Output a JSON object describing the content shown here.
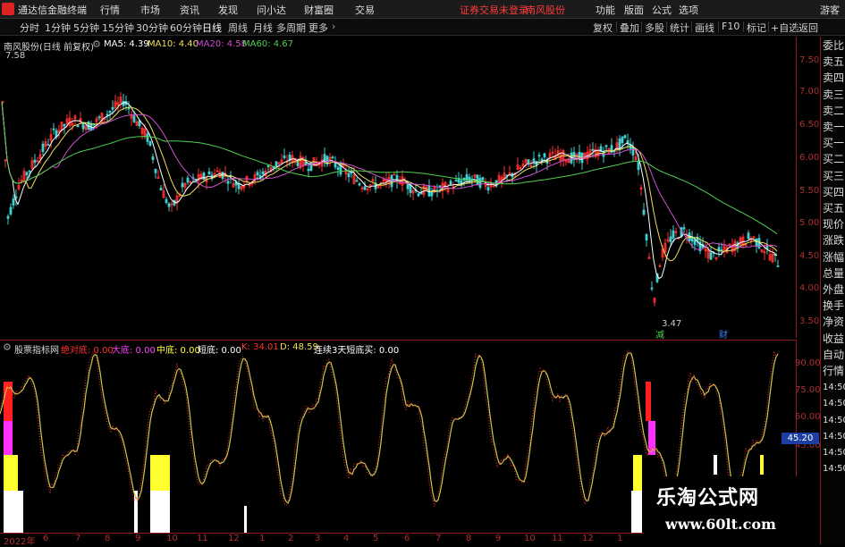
{
  "menubar": {
    "brand": "通达信金融终端",
    "menus": [
      "行情",
      "市场",
      "资讯",
      "发现",
      "问小达",
      "财富圈",
      "交易"
    ],
    "status": "证券交易未登录",
    "stock_name": "南风股份",
    "right_menus": [
      "功能",
      "版面",
      "公式",
      "选项"
    ],
    "guest": "游客"
  },
  "toolbar": {
    "periods": [
      "分时",
      "1分钟",
      "5分钟",
      "15分钟",
      "30分钟",
      "60分钟",
      "日线",
      "周线",
      "月线",
      "多周期",
      "更多"
    ],
    "active_period": "日线",
    "tools": [
      "复权",
      "叠加",
      "多股",
      "统计",
      "画线",
      "F10",
      "标记",
      "+自选",
      "返回"
    ]
  },
  "main_chart": {
    "title": "南风股份(日线 前复权)",
    "ma_labels": [
      {
        "text": "MA5: 4.39",
        "color": "#ffffff"
      },
      {
        "text": "MA10: 4.40",
        "color": "#f0e05a"
      },
      {
        "text": "MA20: 4.58",
        "color": "#d050d0"
      },
      {
        "text": "MA60: 4.67",
        "color": "#50d050"
      }
    ],
    "y_ticks": [
      "7.50",
      "7.00",
      "6.50",
      "6.00",
      "5.50",
      "5.00",
      "4.50",
      "4.00",
      "3.50"
    ],
    "high_label": "7.58",
    "low_label": "3.47",
    "markers": [
      "减",
      "财"
    ]
  },
  "indicator": {
    "title": "股票指标网",
    "labels": [
      {
        "text": "绝对底: 0.00",
        "color": "#ff3030"
      },
      {
        "text": "大底: 0.00",
        "color": "#ff40ff"
      },
      {
        "text": "中底: 0.00",
        "color": "#ffff40"
      },
      {
        "text": "短底: 0.00",
        "color": "#ffffff"
      },
      {
        "text": "K: 34.01",
        "color": "#ff3030"
      },
      {
        "text": "D: 48.59",
        "color": "#f0e05a"
      },
      {
        "text": "连续3天短底买: 0.00",
        "color": "#ffffff"
      }
    ],
    "y_ticks": [
      "90.00",
      "75.00",
      "60.00",
      "45.00"
    ],
    "current_value": "45.20"
  },
  "x_axis": {
    "labels": [
      "2022年",
      "6",
      "7",
      "8",
      "9",
      "10",
      "11",
      "12",
      "1",
      "2",
      "3",
      "4",
      "5",
      "6",
      "7",
      "8",
      "9",
      "10",
      "11",
      "12",
      "1"
    ]
  },
  "right_column": {
    "items": [
      "委比",
      "卖五",
      "卖四",
      "卖三",
      "卖二",
      "卖一",
      "买一",
      "买二",
      "买三",
      "买四",
      "买五",
      "现价",
      "涨跌",
      "涨幅",
      "总量",
      "外盘",
      "换手",
      "净资",
      "收益",
      "自动",
      "行情",
      "14:50",
      "14:50",
      "14:50",
      "14:50",
      "14:50",
      "14:50"
    ]
  },
  "watermark": {
    "line1": "乐淘公式网",
    "line2": "www.60lt.com"
  },
  "colors": {
    "up": "#ff3030",
    "down": "#40d0d0",
    "ma5": "#ffffff",
    "ma10": "#f0e05a",
    "ma20": "#d050d0",
    "ma60": "#50d050",
    "k": "#ff3030",
    "d": "#c8c850",
    "axis_border": "#8b1a1a"
  }
}
